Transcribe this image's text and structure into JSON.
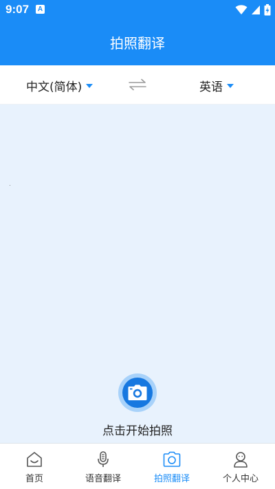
{
  "status_bar": {
    "time": "9:07",
    "notification_badge": "A",
    "icons": [
      "wifi-icon",
      "signal-icon",
      "battery-icon"
    ]
  },
  "header": {
    "title": "拍照翻译"
  },
  "language_bar": {
    "source_language": "中文(简体)",
    "target_language": "英语",
    "swap_icon": "swap-arrows-icon"
  },
  "capture": {
    "label": "点击开始拍照",
    "icon": "camera-icon"
  },
  "tabs": [
    {
      "label": "首页",
      "icon": "home-icon",
      "active": false
    },
    {
      "label": "语音翻译",
      "icon": "microphone-icon",
      "active": false
    },
    {
      "label": "拍照翻译",
      "icon": "camera-icon",
      "active": true
    },
    {
      "label": "个人中心",
      "icon": "person-icon",
      "active": false
    }
  ],
  "colors": {
    "primary": "#1a8cf7",
    "content_bg": "#e8f2fd",
    "capture_button": "#1778e0",
    "text": "#222222"
  }
}
